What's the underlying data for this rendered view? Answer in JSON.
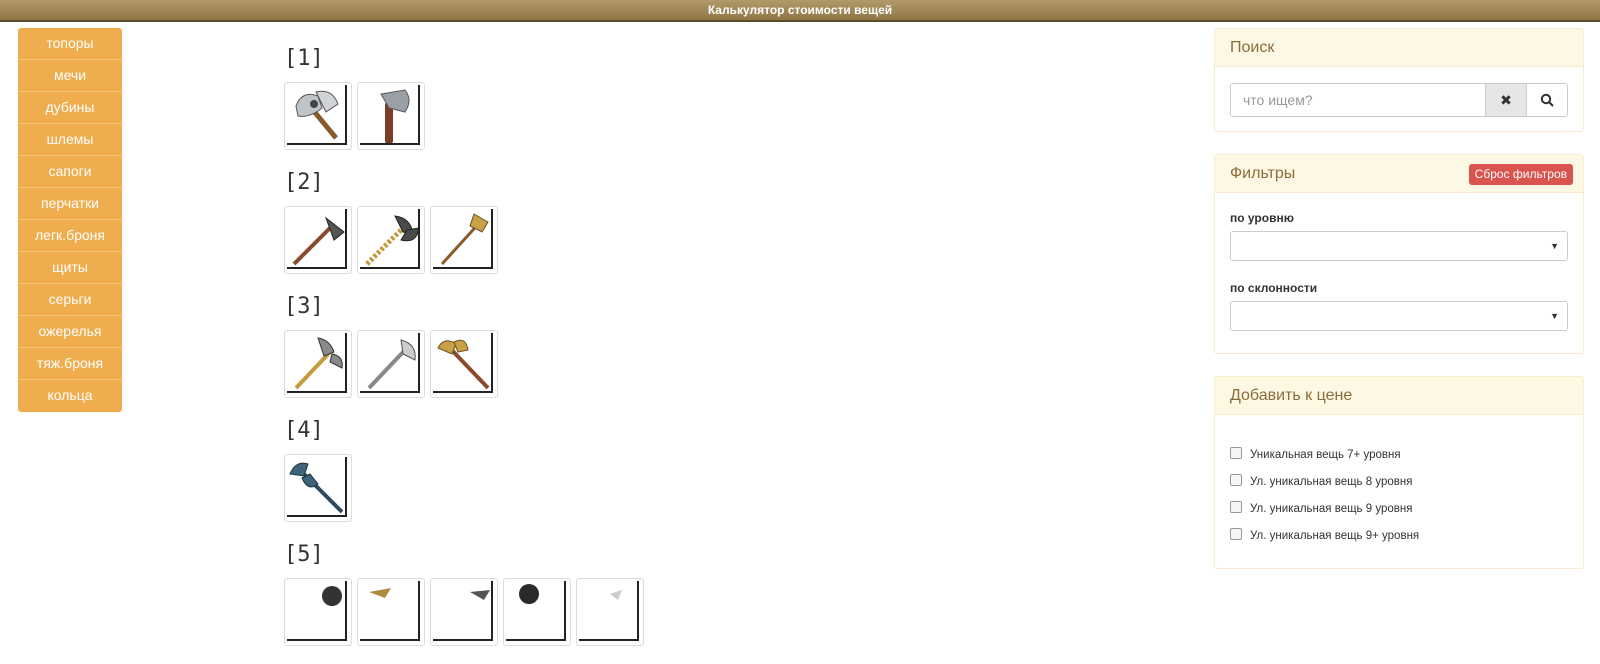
{
  "app": {
    "title": "Калькулятор стоимости вещей"
  },
  "sidebar": {
    "items": [
      {
        "label": "топоры"
      },
      {
        "label": "мечи"
      },
      {
        "label": "дубины"
      },
      {
        "label": "шлемы"
      },
      {
        "label": "сапоги"
      },
      {
        "label": "перчатки"
      },
      {
        "label": "легк.броня"
      },
      {
        "label": "щиты"
      },
      {
        "label": "серьги"
      },
      {
        "label": "ожерелья"
      },
      {
        "label": "тяж.броня"
      },
      {
        "label": "кольца"
      }
    ]
  },
  "main": {
    "groups": [
      {
        "title": "[1]",
        "items": [
          "axe-icon",
          "axe-icon"
        ]
      },
      {
        "title": "[2]",
        "items": [
          "axe-icon",
          "axe-icon",
          "axe-icon"
        ]
      },
      {
        "title": "[3]",
        "items": [
          "axe-icon",
          "axe-icon",
          "axe-icon"
        ]
      },
      {
        "title": "[4]",
        "items": [
          "axe-icon"
        ]
      },
      {
        "title": "[5]",
        "items": [
          "axe-icon",
          "axe-icon",
          "axe-icon",
          "axe-icon",
          "axe-icon"
        ]
      }
    ]
  },
  "search": {
    "title": "Поиск",
    "placeholder": "что ищем?",
    "value": "",
    "clear_icon": "close-icon",
    "search_icon": "search-icon"
  },
  "filters": {
    "title": "Фильтры",
    "reset_label": "Сброс фильтров",
    "level_label": "по уровню",
    "level_value": "",
    "alignment_label": "по склонности",
    "alignment_value": ""
  },
  "price": {
    "title": "Добавить к цене",
    "options": [
      {
        "label": "Уникальная вещь 7+ уровня",
        "checked": false
      },
      {
        "label": "Ул. уникальная вещь 8 уровня",
        "checked": false
      },
      {
        "label": "Ул. уникальная вещь 9 уровня",
        "checked": false
      },
      {
        "label": "Ул. уникальная вещь 9+ уровня",
        "checked": false
      }
    ]
  },
  "colors": {
    "sidebar": "#f0ad4e",
    "topbar": "#a08659",
    "panel_heading": "#fcf8e3",
    "danger": "#d9534f"
  }
}
